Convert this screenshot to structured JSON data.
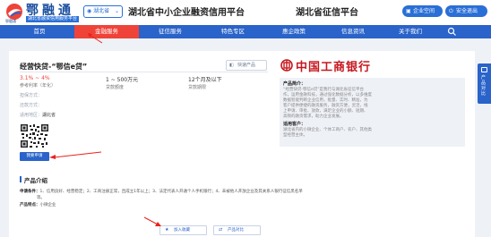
{
  "header": {
    "logo_text": "鄂融通",
    "logo_subtitle": "湖北省融资信用服务平台",
    "logo_small": "鄂融通",
    "region_selector": "湖北省",
    "platform_name": "湖北省中小企业融资信用平台",
    "credit_platform": "湖北省征信平台",
    "enterprise_space_button": "企业空间",
    "logout_button": "安全退出",
    "brand_color": "#2a63c9",
    "accent_color": "#ef4339"
  },
  "nav": {
    "items": [
      {
        "label": "首页",
        "active": false
      },
      {
        "label": "金融服务",
        "active": true
      },
      {
        "label": "征信服务",
        "active": false
      },
      {
        "label": "特色专区",
        "active": false
      },
      {
        "label": "惠企政策",
        "active": false
      },
      {
        "label": "信息资讯",
        "active": false
      },
      {
        "label": "关于我们",
        "active": false
      }
    ],
    "search_icon": "search-icon"
  },
  "product": {
    "title": "经营快贷-“鄂信e贷”",
    "tag": "快速产品",
    "rate": "3.1% ~ 4%",
    "rate_label": "参考利率（年化）",
    "amount": "1 ~ 500万元",
    "amount_label": "贷款额度",
    "term": "12个月及以下",
    "term_label": "贷款期限",
    "guarantee_label": "担保方式：",
    "method_label": "还款方式：",
    "region_label": "适用地区：",
    "region_value": "湖北省",
    "apply_button": "我要申请",
    "qr_icon": "qr-code-icon"
  },
  "bank": {
    "name": "中国工商银行",
    "logo_icon": "icbc-logo-icon",
    "intro_heading": "产品简介：",
    "intro_lines": [
      "“经营快贷-鄂信e贷”是我行与湖北省征信平台",
      "作，运用金融科技，通过强化数据分析，以多维度",
      "数据智能判断企业信用，批量、实时、精准，为",
      "客户提供便捷的融资服务，融资方便，灵活，线",
      "上申请、审批、放款，满足企业的小额、短期、",
      "高频的融资需求，助力企业发展。"
    ],
    "customer_heading": "适用客户：",
    "customer_lines": [
      "湖北省内的小微企业、个体工商户、农户、其他类",
      "型经营主体。"
    ]
  },
  "intro_section": {
    "title": "产品介绍",
    "conditions_label": "申请条件：",
    "conditions_line1": "1、信用良好、经营稳定；2、工商注册正常，且成立1年以上；3、法定代表人开通个人手机银行；4、未被他人开放企业及其关系人银行征信黑名单",
    "conditions_line2": "等。",
    "features_label": "产品特点：",
    "features_value": "小微企业"
  },
  "footer_buttons": {
    "save": "加入收藏",
    "compare": "产品对比"
  },
  "side_float": {
    "label": "产品对比"
  }
}
